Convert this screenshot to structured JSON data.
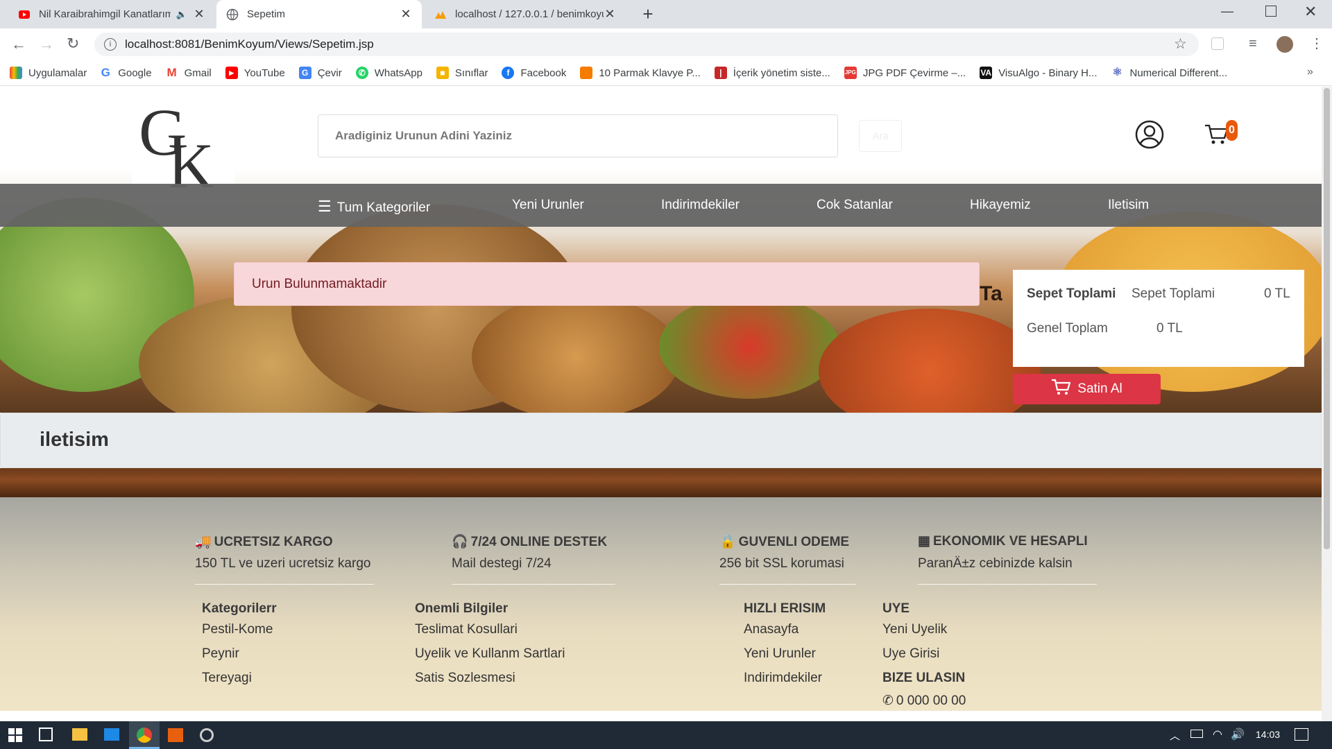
{
  "browser": {
    "tabs": [
      {
        "title": "Nil Karaibrahimgil Kanatlarım",
        "active": false
      },
      {
        "title": "Sepetim",
        "active": true
      },
      {
        "title": "localhost / 127.0.0.1 / benimkoyu",
        "active": false
      }
    ],
    "new_tab_label": "+",
    "url": "localhost:8081/BenimKoyum/Views/Sepetim.jsp",
    "bookmarks": [
      {
        "label": "Uygulamalar",
        "icon": "apps-grid-icon"
      },
      {
        "label": "Google",
        "icon": "google-icon"
      },
      {
        "label": "Gmail",
        "icon": "gmail-icon"
      },
      {
        "label": "YouTube",
        "icon": "youtube-icon"
      },
      {
        "label": "Çevir",
        "icon": "translate-icon"
      },
      {
        "label": "WhatsApp",
        "icon": "whatsapp-icon"
      },
      {
        "label": "Sınıflar",
        "icon": "classroom-icon"
      },
      {
        "label": "Facebook",
        "icon": "facebook-icon"
      },
      {
        "label": "10 Parmak Klavye P...",
        "icon": "keyboard-site-icon"
      },
      {
        "label": "İçerik yönetim siste...",
        "icon": "cms-icon"
      },
      {
        "label": "JPG PDF Çevirme –...",
        "icon": "pdf-icon"
      },
      {
        "label": "VisuAlgo - Binary H...",
        "icon": "visualgo-icon"
      },
      {
        "label": "Numerical Different...",
        "icon": "atom-icon"
      }
    ],
    "more_bookmarks": "»"
  },
  "site": {
    "logo_text": "GK",
    "search_placeholder": "Aradiginiz Urunun Adini Yaziniz",
    "search_button": "Ara",
    "cart_count": "0",
    "nav": [
      "Tum Kategoriler",
      "Yeni Urunler",
      "Indirimdekiler",
      "Cok Satanlar",
      "Hikayemiz",
      "Iletisim"
    ],
    "alert": "Urun Bulunmamaktadir",
    "cart_summary": {
      "label_bold": "Sepet Toplami",
      "label": "Sepet Toplami",
      "value": "0 TL",
      "total_label": "Genel Toplam",
      "total_value": "0 TL"
    },
    "buy_button": "Satin Al",
    "contact_title": "iletisim",
    "hero_partial_text": "Ta"
  },
  "footer": {
    "features": [
      {
        "title": "UCRETSIZ KARGO",
        "text": "150 TL ve uzeri ucretsiz kargo",
        "icon": "truck-icon"
      },
      {
        "title": "7/24 ONLINE DESTEK",
        "text": "Mail destegi 7/24",
        "icon": "headset-icon"
      },
      {
        "title": "GUVENLI ODEME",
        "text": "256 bit SSL korumasi",
        "icon": "secure-payment-icon"
      },
      {
        "title": "EKONOMIK VE HESAPLI",
        "text": "ParanÄ±z cebinizde kalsin",
        "icon": "calculator-icon"
      }
    ],
    "columns": [
      {
        "title": "Kategorilerr",
        "items": [
          "Pestil-Kome",
          "Peynir",
          "Tereyagi"
        ]
      },
      {
        "title": "Onemli Bilgiler",
        "items": [
          "Teslimat Kosullari",
          "Uyelik ve Kullanm Sartlari",
          "Satis Sozlesmesi"
        ]
      },
      {
        "title": "HIZLI ERISIM",
        "items": [
          "Anasayfa",
          "Yeni Urunler",
          "Indirimdekiler"
        ]
      },
      {
        "title": "UYE",
        "items": [
          "Yeni Uyelik",
          "Uye Girisi"
        ]
      }
    ],
    "contact_heading": "BIZE ULASIN",
    "phone_partial": "0 000 00 00"
  },
  "taskbar": {
    "time": "14:03"
  },
  "colors": {
    "accent_red": "#dc3545",
    "nav_bg": "#646464",
    "alert_bg": "#f8d7da",
    "cart_badge": "#e8590c"
  }
}
